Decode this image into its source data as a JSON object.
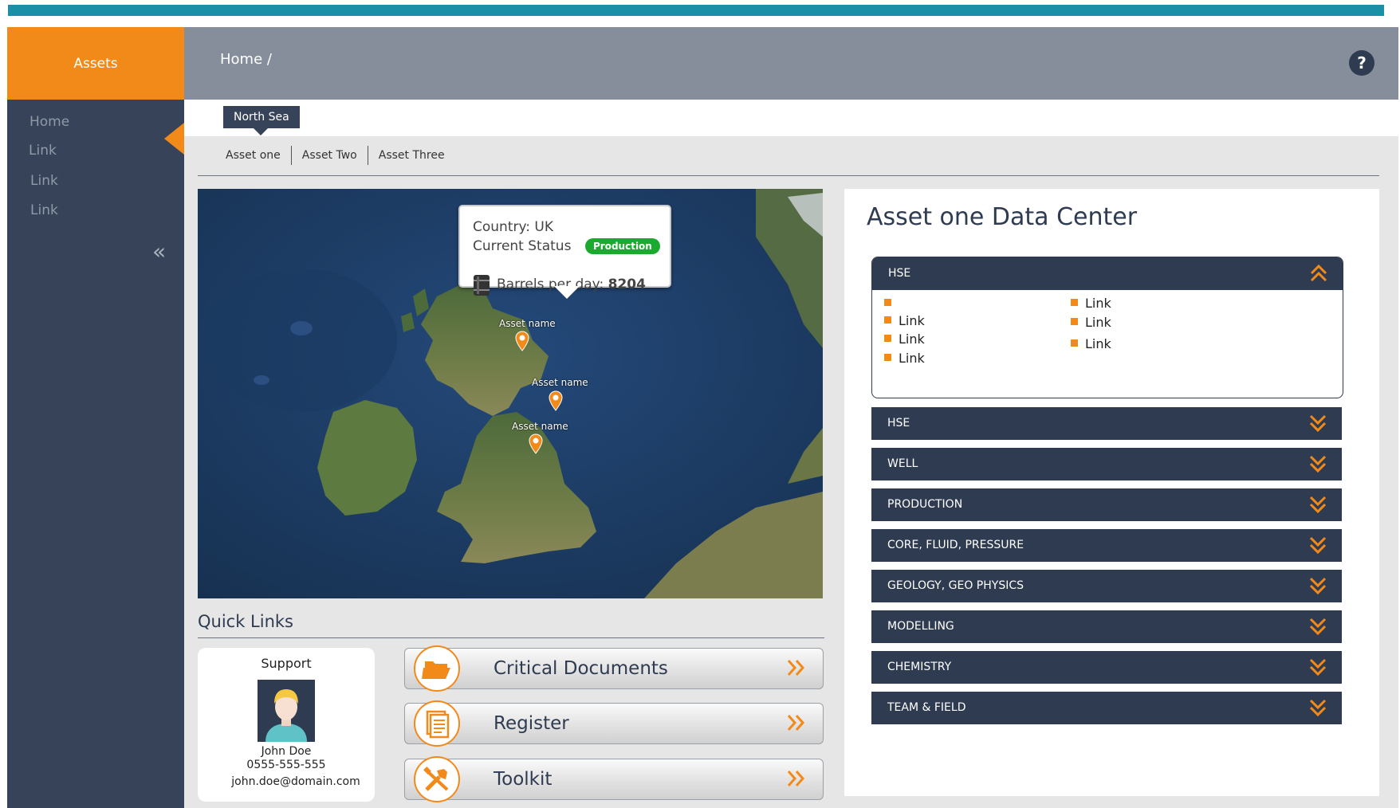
{
  "header": {
    "app_tab": "Assets",
    "breadcrumb": "Home /",
    "help_icon": "help-icon"
  },
  "sidebar": {
    "items": [
      {
        "label": "Home"
      },
      {
        "label": "Link"
      },
      {
        "label": "Link"
      },
      {
        "label": "Link"
      }
    ],
    "collapse_icon": "double-chevron-left-icon"
  },
  "region": {
    "label": "North Sea"
  },
  "asset_tabs": [
    {
      "label": "Asset one"
    },
    {
      "label": "Asset Two"
    },
    {
      "label": "Asset Three"
    }
  ],
  "map": {
    "popup": {
      "country": "Country: UK",
      "status_label": "Current Status",
      "status_badge": "Production",
      "barrels_label": "Barrels per day:",
      "barrels_value": "8204",
      "barrel_icon": "oil-barrel-icon"
    },
    "pins": [
      {
        "label": "Asset name",
        "icon": "map-pin-icon"
      },
      {
        "label": "Asset name",
        "icon": "map-pin-icon"
      },
      {
        "label": "Asset name",
        "icon": "map-pin-icon"
      }
    ]
  },
  "quick_links": {
    "title": "Quick Links",
    "support": {
      "title": "Support",
      "name": "John Doe",
      "phone": "0555-555-555",
      "email": "john.doe@domain.com"
    },
    "buttons": [
      {
        "label": "Critical Documents",
        "icon": "folder-icon"
      },
      {
        "label": "Register",
        "icon": "document-icon"
      },
      {
        "label": "Toolkit",
        "icon": "tools-icon"
      }
    ]
  },
  "data_center": {
    "title": "Asset one Data Center",
    "open_section": {
      "label": "HSE",
      "links_left": [
        "",
        "Link",
        "Link",
        "Link"
      ],
      "links_right": [
        "Link",
        "Link",
        "Link"
      ]
    },
    "sections": [
      {
        "label": "HSE"
      },
      {
        "label": "WELL"
      },
      {
        "label": "PRODUCTION"
      },
      {
        "label": "CORE, FLUID, PRESSURE"
      },
      {
        "label": "GEOLOGY, GEO PHYSICS"
      },
      {
        "label": "MODELLING"
      },
      {
        "label": "CHEMISTRY"
      },
      {
        "label": "TEAM & FIELD"
      }
    ]
  },
  "colors": {
    "accent": "#f28a1a",
    "navy": "#2f3b50",
    "sidebar": "#374359",
    "topbar": "#1b8fa5",
    "header": "#868e9c",
    "status_green": "#1aab2e"
  }
}
